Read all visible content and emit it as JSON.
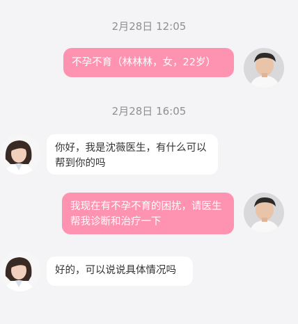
{
  "messages": [
    {
      "type": "time",
      "text": "2月28日 12:05"
    },
    {
      "type": "outgoing",
      "sender": "user",
      "text": "不孕不育（林林林，女，22岁）"
    },
    {
      "type": "time",
      "text": "2月28日 16:05"
    },
    {
      "type": "incoming",
      "sender": "doctor",
      "text": "你好，我是沈薇医生，有什么可以帮到你的吗"
    },
    {
      "type": "outgoing",
      "sender": "user",
      "text": "我现在有不孕不育的困扰，请医生帮我诊断和治疗一下"
    },
    {
      "type": "incoming",
      "sender": "doctor",
      "text": "好的，可以说说具体情况吗"
    }
  ],
  "colors": {
    "background": "#f4f4f6",
    "outgoing_bubble": "#fd93b1",
    "incoming_bubble": "#ffffff",
    "timestamp_text": "#8f8f93"
  },
  "icons": {
    "user_avatar": "user-avatar-photo",
    "doctor_avatar": "doctor-avatar-photo"
  }
}
